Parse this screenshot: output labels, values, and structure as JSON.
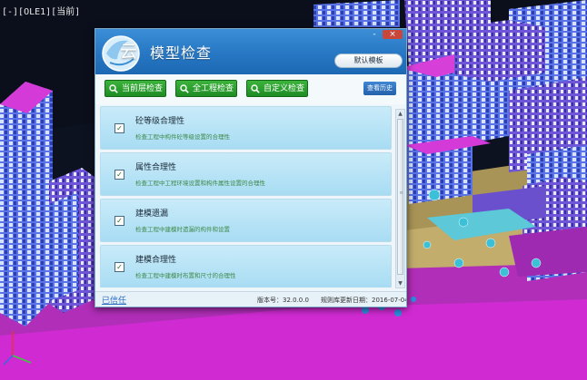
{
  "viewport": {
    "label": "[-][OLE1][当前]"
  },
  "dialog": {
    "logo_glyph": "云",
    "title": "模型检查",
    "minimize_label": "-",
    "close_label": "×",
    "template_button": "默认模板",
    "toolbar": {
      "current_floor_check": "当前层检查",
      "full_project_check": "全工程检查",
      "custom_check": "自定义检查",
      "history": "查看历史"
    },
    "items": [
      {
        "checked": true,
        "check_mark": "✓",
        "title": "砼等级合理性",
        "desc": "检查工程中构件砼等级设置的合理性"
      },
      {
        "checked": true,
        "check_mark": "✓",
        "title": "属性合理性",
        "desc": "检查工程中工程环境设置和构件属性设置的合理性"
      },
      {
        "checked": true,
        "check_mark": "✓",
        "title": "建模遗漏",
        "desc": "检查工程中建模时遗漏的构件和设置"
      },
      {
        "checked": true,
        "check_mark": "✓",
        "title": "建模合理性",
        "desc": "检查工程中建模时布置和尺寸的合理性"
      }
    ],
    "scrollbar": {
      "up": "▲",
      "down": "▼",
      "grip": "≡"
    },
    "footer": {
      "trusted": "已信任",
      "version": "版本号：32.0.0.0",
      "rule_update_date": "规则库更新日期：2016-07-04"
    }
  },
  "colors": {
    "building_magenta": "#c020c8",
    "building_blue": "#4a6ae0",
    "ground": "#b8a468",
    "dialog_header": "#2777c4",
    "green_button": "#2a9a2e"
  }
}
